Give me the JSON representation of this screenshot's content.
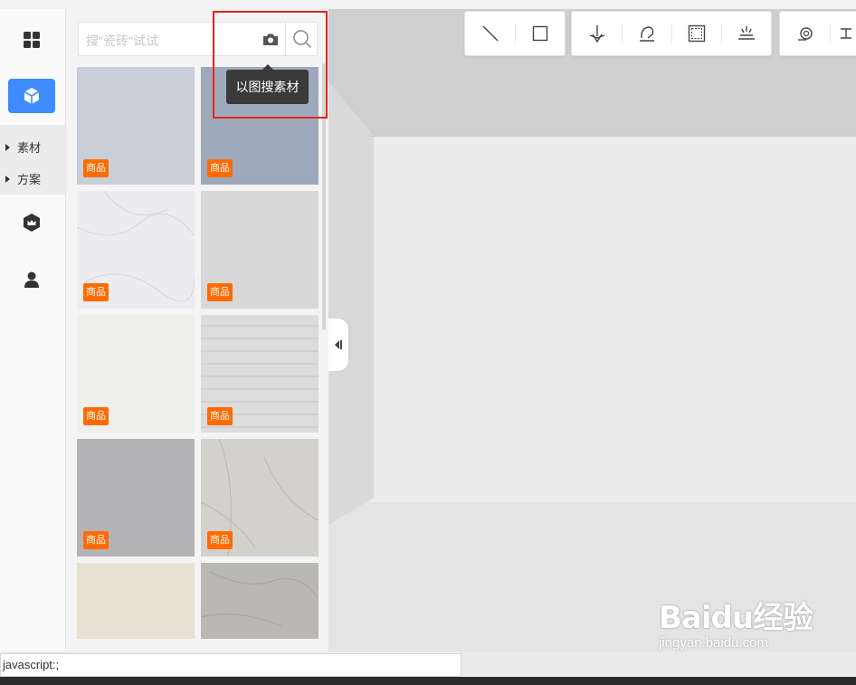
{
  "search": {
    "placeholder": "搜\"瓷砖\"试试"
  },
  "tooltip": {
    "text": "以图搜素材"
  },
  "submenu": {
    "items": [
      "素材",
      "方案"
    ]
  },
  "tiles": [
    {
      "badge": "商品",
      "color": "#c9cfd9"
    },
    {
      "badge": "商品",
      "color": "#9ea9bc"
    },
    {
      "badge": "商品",
      "color": "#ececee"
    },
    {
      "badge": "商品",
      "color": "#d7d7d7"
    },
    {
      "badge": "商品",
      "color": "#efefeb"
    },
    {
      "badge": "商品",
      "color": "#dcdcdc"
    },
    {
      "badge": "商品",
      "color": "#b3b3b5"
    },
    {
      "badge": "商品",
      "color": "#d3d1cc"
    },
    {
      "badge": "",
      "color": "#e7e1d3"
    },
    {
      "badge": "",
      "color": "#b9b8b5"
    }
  ],
  "toolbar": {
    "icons": [
      "line-icon",
      "rectangle-icon",
      "compass-icon",
      "rotate-icon",
      "frame-icon",
      "light-icon",
      "spiral-icon",
      "more-icon"
    ]
  },
  "statusbar": {
    "text": "javascript:;"
  },
  "watermark": {
    "logo": "Baidu经验",
    "url": "jingyan.baidu.com"
  },
  "colors": {
    "accent": "#3d8bff",
    "badge": "#ff6a00",
    "highlight": "#e8231b"
  }
}
